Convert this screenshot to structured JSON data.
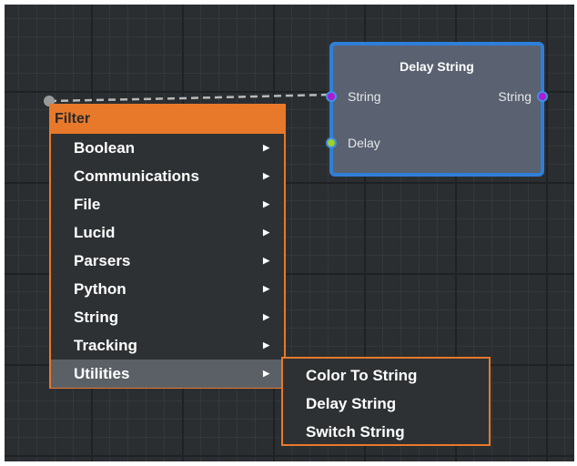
{
  "node": {
    "title": "Delay String",
    "input_string_label": "String",
    "output_string_label": "String",
    "input_delay_label": "Delay"
  },
  "menu": {
    "header": "Filter",
    "items": [
      {
        "label": "Boolean"
      },
      {
        "label": "Communications"
      },
      {
        "label": "File"
      },
      {
        "label": "Lucid"
      },
      {
        "label": "Parsers"
      },
      {
        "label": "Python"
      },
      {
        "label": "String"
      },
      {
        "label": "Tracking"
      },
      {
        "label": "Utilities",
        "selected": true
      }
    ],
    "submenu_arrow_icon": "chevron-right-icon"
  },
  "submenu": {
    "items": [
      {
        "label": "Color To String"
      },
      {
        "label": "Delay String"
      },
      {
        "label": "Switch String"
      }
    ]
  },
  "colors": {
    "canvas_background": "#2b2e31",
    "node_border": "#2f7fd8",
    "menu_accent": "#e8792a",
    "string_port": "#b01ad0",
    "delay_port": "#9ed12b"
  }
}
